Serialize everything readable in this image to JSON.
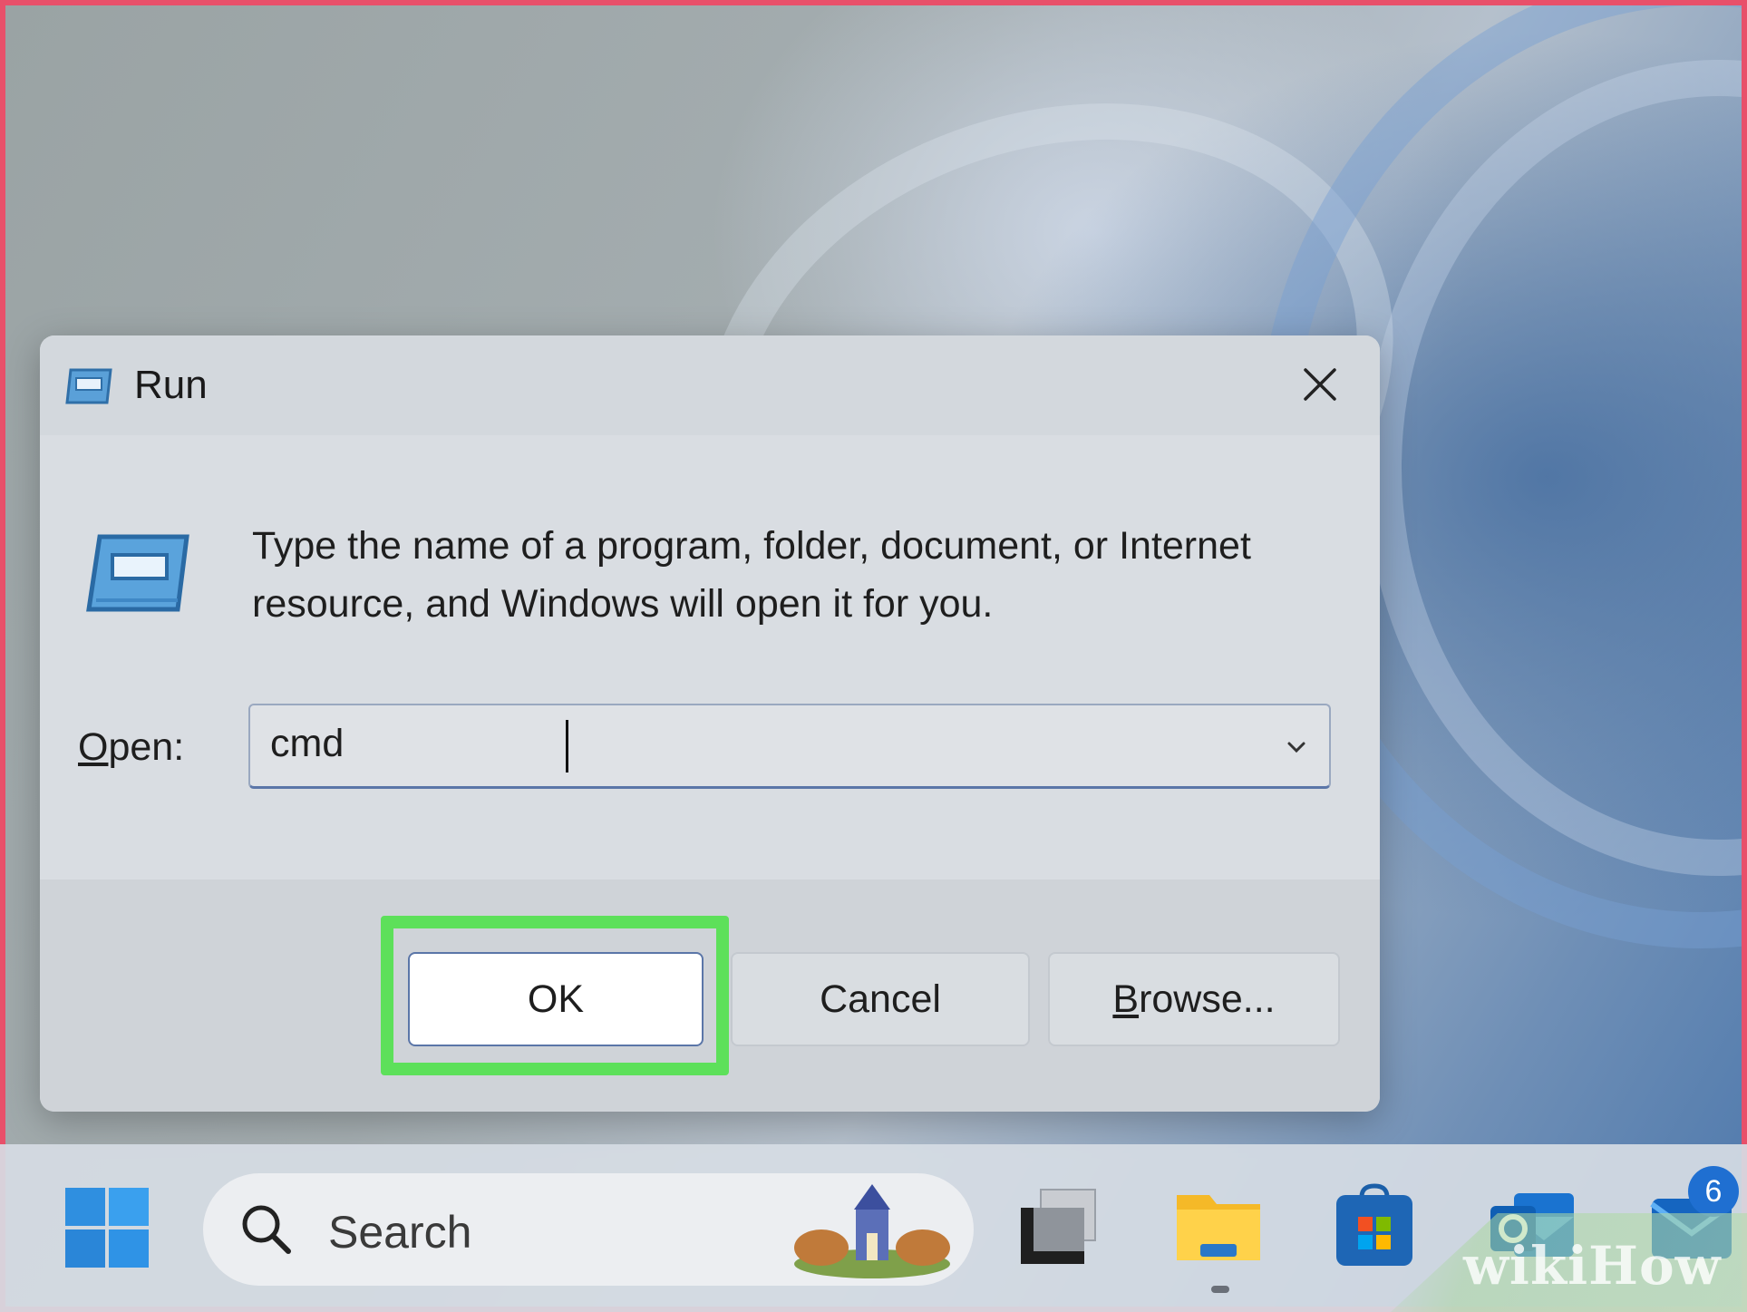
{
  "dialog": {
    "title": "Run",
    "description": "Type the name of a program, folder, document, or Internet resource, and Windows will open it for you.",
    "open_label": "Open:",
    "open_label_access": "O",
    "open_label_rest": "pen:",
    "open_value": "cmd",
    "ok_label": "OK",
    "cancel_label": "Cancel",
    "browse_access": "B",
    "browse_rest": "rowse...",
    "icons": {
      "title": "run-app-icon",
      "body": "run-app-icon",
      "close": "close-icon",
      "dropdown": "chevron-down-icon"
    }
  },
  "taskbar": {
    "search_label": "Search",
    "mail_badge": "6",
    "icons": [
      "windows-start-icon",
      "search-icon",
      "task-view-icon",
      "file-explorer-icon",
      "microsoft-store-icon",
      "outlook-icon",
      "mail-icon"
    ]
  },
  "highlight_color": "#5de05a",
  "watermark": "wikiHow"
}
